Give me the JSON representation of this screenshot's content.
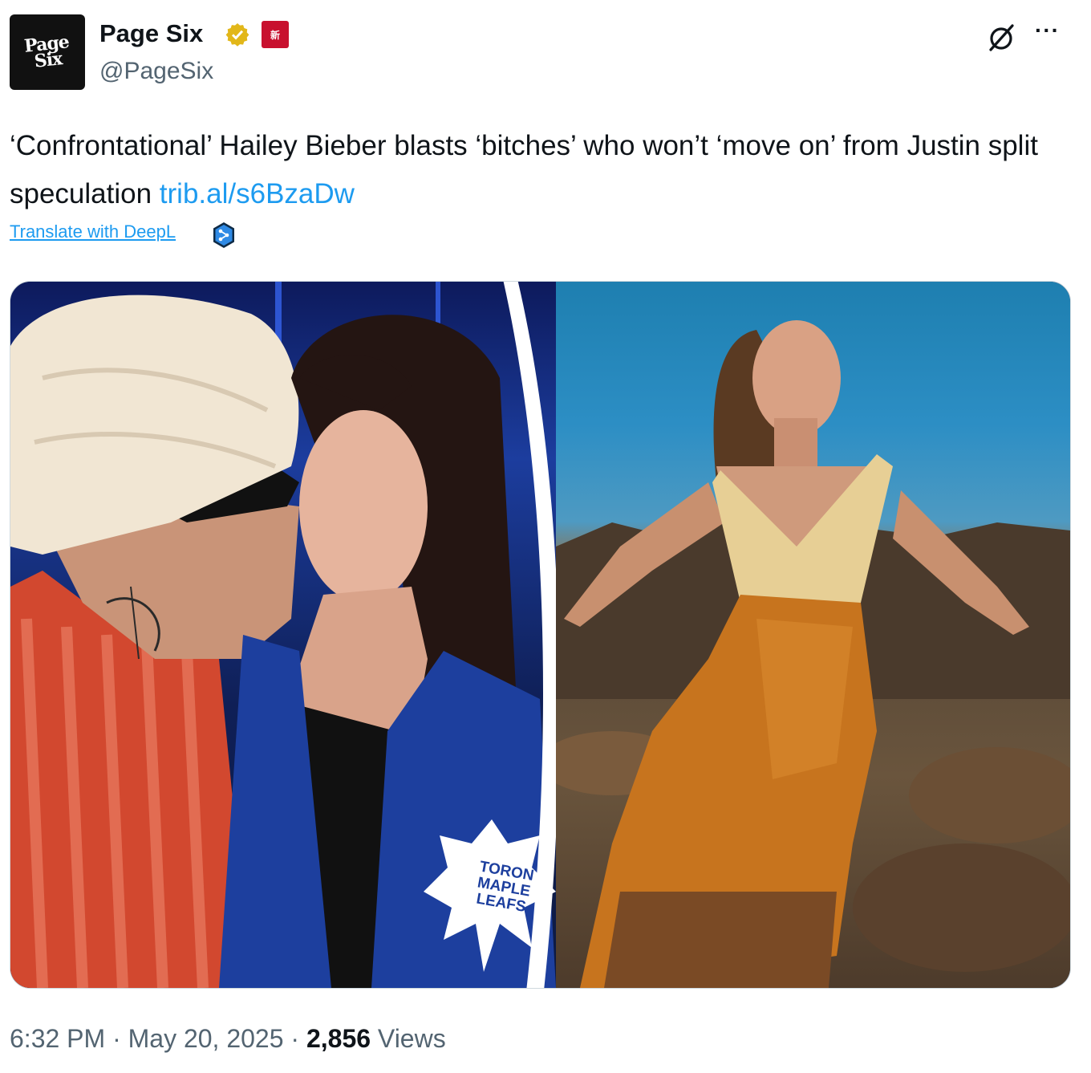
{
  "account": {
    "avatar_text": "Page Six",
    "name": "Page Six",
    "handle": "@PageSix",
    "affiliate_badge_text": "新"
  },
  "tweet": {
    "text": "‘Confrontational’ Hailey Bieber blasts ‘bitches’ who won’t ‘move on’ from Justin split speculation ",
    "link": "trib.al/s6BzaDw",
    "translate_label": "Translate with DeepL"
  },
  "media": {
    "left_jersey_text": "TORONTO MAPLE LEAFS",
    "left_jersey_lines": [
      "TORON",
      "MAPLE",
      "LEAFS"
    ]
  },
  "meta": {
    "time": "6:32 PM",
    "separator": "·",
    "date": "May 20, 2025",
    "views_count": "2,856",
    "views_label": "Views"
  },
  "colors": {
    "link": "#1d9bf0",
    "secondary_text": "#536471",
    "verified": "#e2b719"
  },
  "icons": {
    "verified": "gold-checkmark-badge",
    "grok": "grok-slash-circle",
    "more": "ellipsis",
    "deepl": "deepl-logo"
  }
}
